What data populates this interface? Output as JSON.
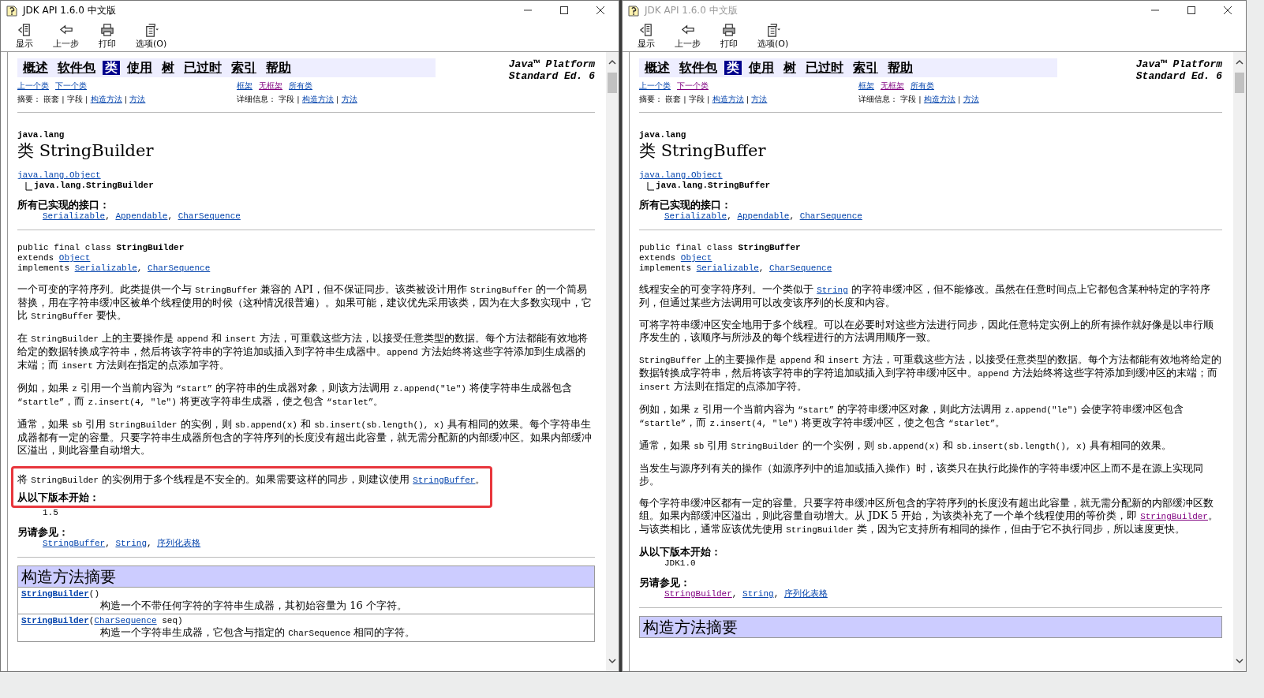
{
  "windows": [
    {
      "title": "JDK API 1.6.0 中文版",
      "active": true,
      "toolbar": [
        {
          "label": "显示"
        },
        {
          "label": "上一步"
        },
        {
          "label": "打印"
        },
        {
          "label": "选项(O)"
        }
      ],
      "nav": [
        {
          "label": "概述",
          "selected": false
        },
        {
          "label": "软件包",
          "selected": false
        },
        {
          "label": "类",
          "selected": true
        },
        {
          "label": "使用",
          "selected": false
        },
        {
          "label": "树",
          "selected": false
        },
        {
          "label": "已过时",
          "selected": false
        },
        {
          "label": "索引",
          "selected": false
        },
        {
          "label": "帮助",
          "selected": false
        }
      ],
      "platform": [
        "Java™ Platform",
        "Standard Ed. 6"
      ],
      "prev_next": [
        {
          "link": "上一个类",
          "visited": false
        },
        {
          "link": "下一个类",
          "visited": false
        }
      ],
      "frames": [
        {
          "link": "框架",
          "visited": false
        },
        {
          "link": "无框架",
          "visited": true
        },
        {
          "link": "所有类",
          "visited": false
        }
      ],
      "summary_line": [
        {
          "text": "摘要： 嵌套 | 字段 | "
        },
        {
          "link": "构造方法",
          "visited": false
        },
        {
          "text": " | "
        },
        {
          "link": "方法",
          "visited": false
        }
      ],
      "detail_line": [
        {
          "text": "详细信息： 字段 | "
        },
        {
          "link": "构造方法",
          "visited": false
        },
        {
          "text": " | "
        },
        {
          "link": "方法",
          "visited": false
        }
      ],
      "package": "java.lang",
      "class_title": "类 StringBuilder",
      "hierarchy": {
        "parent": "java.lang.Object",
        "child": "java.lang.StringBuilder"
      },
      "interfaces": {
        "label": "所有已实现的接口：",
        "items": [
          {
            "link": "Serializable",
            "visited": false
          },
          {
            "text": ", "
          },
          {
            "link": "Appendable",
            "visited": false
          },
          {
            "text": ", "
          },
          {
            "link": "CharSequence",
            "visited": false
          }
        ]
      },
      "signature": [
        [
          {
            "text": "public final class "
          },
          {
            "bold": "StringBuilder"
          }
        ],
        [
          {
            "text": "extends "
          },
          {
            "link": "Object",
            "visited": false
          }
        ],
        [
          {
            "text": "implements "
          },
          {
            "link": "Serializable",
            "visited": false
          },
          {
            "text": ", "
          },
          {
            "link": "CharSequence",
            "visited": false
          }
        ]
      ],
      "paragraphs": [
        {
          "highlighted": false,
          "segments": [
            {
              "text": "一个可变的字符序列。此类提供一个与 "
            },
            {
              "code": "StringBuffer"
            },
            {
              "text": " 兼容的 API，但不保证同步。该类被设计用作 "
            },
            {
              "code": "StringBuffer"
            },
            {
              "text": " 的一个简易替换，用在字符串缓冲区被单个线程使用的时候（这种情况很普遍）。如果可能，建议优先采用该类，因为在大多数实现中，它比 "
            },
            {
              "code": "StringBuffer"
            },
            {
              "text": " 要快。"
            }
          ]
        },
        {
          "highlighted": false,
          "segments": [
            {
              "text": "在 "
            },
            {
              "code": "StringBuilder"
            },
            {
              "text": " 上的主要操作是 "
            },
            {
              "code": "append"
            },
            {
              "text": " 和 "
            },
            {
              "code": "insert"
            },
            {
              "text": " 方法，可重载这些方法，以接受任意类型的数据。每个方法都能有效地将给定的数据转换成字符串，然后将该字符串的字符追加或插入到字符串生成器中。"
            },
            {
              "code": "append"
            },
            {
              "text": " 方法始终将这些字符添加到生成器的末端；而 "
            },
            {
              "code": "insert"
            },
            {
              "text": " 方法则在指定的点添加字符。"
            }
          ]
        },
        {
          "highlighted": false,
          "segments": [
            {
              "text": "例如，如果 "
            },
            {
              "code": "z"
            },
            {
              "text": " 引用一个当前内容为 "
            },
            {
              "code": "“start”"
            },
            {
              "text": " 的字符串的生成器对象，则该方法调用 "
            },
            {
              "code": "z.append(\"le\")"
            },
            {
              "text": " 将使字符串生成器包含 "
            },
            {
              "code": "“startle”"
            },
            {
              "text": "，而 "
            },
            {
              "code": "z.insert(4, \"le\")"
            },
            {
              "text": " 将更改字符串生成器，使之包含 "
            },
            {
              "code": "“starlet”"
            },
            {
              "text": "。"
            }
          ]
        },
        {
          "highlighted": false,
          "segments": [
            {
              "text": "通常，如果 "
            },
            {
              "code": "sb"
            },
            {
              "text": " 引用 "
            },
            {
              "code": "StringBuilder"
            },
            {
              "text": " 的实例，则 "
            },
            {
              "code": "sb.append(x)"
            },
            {
              "text": " 和 "
            },
            {
              "code": "sb.insert(sb.length(), x)"
            },
            {
              "text": " 具有相同的效果。每个字符串生成器都有一定的容量。只要字符串生成器所包含的字符序列的长度没有超出此容量，就无需分配新的内部缓冲区。如果内部缓冲区溢出，则此容量自动增大。"
            }
          ]
        },
        {
          "highlighted": true,
          "segments": [
            {
              "text": "将 "
            },
            {
              "code": "StringBuilder"
            },
            {
              "text": " 的实例用于多个线程是不安全的。如果需要这样的同步，则建议使用 "
            },
            {
              "link": "StringBuffer",
              "visited": false
            },
            {
              "text": "。"
            }
          ]
        }
      ],
      "since": {
        "label": "从以下版本开始：",
        "version": "1.5",
        "highlighted": true
      },
      "see_also": {
        "label": "另请参见：",
        "items": [
          {
            "link": "StringBuffer",
            "visited": false
          },
          {
            "text": ", "
          },
          {
            "link": "String",
            "visited": false
          },
          {
            "text": ", "
          },
          {
            "link": "序列化表格",
            "visited": false
          }
        ]
      },
      "constructor_summary": {
        "title": "构造方法摘要",
        "rows": [
          {
            "name": [
              {
                "link": "StringBuilder",
                "visited": false
              },
              {
                "text": "()"
              }
            ],
            "description": [
              {
                "text": "构造一个不带任何字符的字符串生成器，其初始容量为 16 个字符。"
              }
            ]
          },
          {
            "name": [
              {
                "link": "StringBuilder",
                "visited": false
              },
              {
                "text": "("
              },
              {
                "link": "CharSequence",
                "visited": false
              },
              {
                "text": " seq)"
              }
            ],
            "description": [
              {
                "text": "构造一个字符串生成器，它包含与指定的 "
              },
              {
                "code": "CharSequence"
              },
              {
                "text": " 相同的字符。"
              }
            ]
          }
        ]
      }
    },
    {
      "title": "JDK API 1.6.0 中文版",
      "active": false,
      "toolbar": [
        {
          "label": "显示"
        },
        {
          "label": "上一步"
        },
        {
          "label": "打印"
        },
        {
          "label": "选项(O)"
        }
      ],
      "nav": [
        {
          "label": "概述",
          "selected": false
        },
        {
          "label": "软件包",
          "selected": false
        },
        {
          "label": "类",
          "selected": true
        },
        {
          "label": "使用",
          "selected": false
        },
        {
          "label": "树",
          "selected": false
        },
        {
          "label": "已过时",
          "selected": false
        },
        {
          "label": "索引",
          "selected": false
        },
        {
          "label": "帮助",
          "selected": false
        }
      ],
      "platform": [
        "Java™ Platform",
        "Standard Ed. 6"
      ],
      "prev_next": [
        {
          "link": "上一个类",
          "visited": false
        },
        {
          "link": "下一个类",
          "visited": true
        }
      ],
      "frames": [
        {
          "link": "框架",
          "visited": false
        },
        {
          "link": "无框架",
          "visited": true
        },
        {
          "link": "所有类",
          "visited": false
        }
      ],
      "summary_line": [
        {
          "text": "摘要： 嵌套 | 字段 | "
        },
        {
          "link": "构造方法",
          "visited": false
        },
        {
          "text": " | "
        },
        {
          "link": "方法",
          "visited": false
        }
      ],
      "detail_line": [
        {
          "text": "详细信息： 字段 | "
        },
        {
          "link": "构造方法",
          "visited": false
        },
        {
          "text": " | "
        },
        {
          "link": "方法",
          "visited": false
        }
      ],
      "package": "java.lang",
      "class_title": "类 StringBuffer",
      "hierarchy": {
        "parent": "java.lang.Object",
        "child": "java.lang.StringBuffer"
      },
      "interfaces": {
        "label": "所有已实现的接口：",
        "items": [
          {
            "link": "Serializable",
            "visited": false
          },
          {
            "text": ", "
          },
          {
            "link": "Appendable",
            "visited": false
          },
          {
            "text": ", "
          },
          {
            "link": "CharSequence",
            "visited": false
          }
        ]
      },
      "signature": [
        [
          {
            "text": "public final class "
          },
          {
            "bold": "StringBuffer"
          }
        ],
        [
          {
            "text": "extends "
          },
          {
            "link": "Object",
            "visited": false
          }
        ],
        [
          {
            "text": "implements "
          },
          {
            "link": "Serializable",
            "visited": false
          },
          {
            "text": ", "
          },
          {
            "link": "CharSequence",
            "visited": false
          }
        ]
      ],
      "paragraphs": [
        {
          "highlighted": false,
          "segments": [
            {
              "text": "线程安全的可变字符序列。一个类似于 "
            },
            {
              "link": "String",
              "visited": false
            },
            {
              "text": " 的字符串缓冲区，但不能修改。虽然在任意时间点上它都包含某种特定的字符序列，但通过某些方法调用可以改变该序列的长度和内容。"
            }
          ]
        },
        {
          "highlighted": false,
          "segments": [
            {
              "text": "可将字符串缓冲区安全地用于多个线程。可以在必要时对这些方法进行同步，因此任意特定实例上的所有操作就好像是以串行顺序发生的，该顺序与所涉及的每个线程进行的方法调用顺序一致。"
            }
          ]
        },
        {
          "highlighted": false,
          "segments": [
            {
              "code": "StringBuffer"
            },
            {
              "text": " 上的主要操作是 "
            },
            {
              "code": "append"
            },
            {
              "text": " 和 "
            },
            {
              "code": "insert"
            },
            {
              "text": " 方法，可重载这些方法，以接受任意类型的数据。每个方法都能有效地将给定的数据转换成字符串，然后将该字符串的字符追加或插入到字符串缓冲区中。"
            },
            {
              "code": "append"
            },
            {
              "text": " 方法始终将这些字符添加到缓冲区的末端；而 "
            },
            {
              "code": "insert"
            },
            {
              "text": " 方法则在指定的点添加字符。"
            }
          ]
        },
        {
          "highlighted": false,
          "segments": [
            {
              "text": "例如，如果 "
            },
            {
              "code": "z"
            },
            {
              "text": " 引用一个当前内容为 "
            },
            {
              "code": "“start”"
            },
            {
              "text": " 的字符串缓冲区对象，则此方法调用 "
            },
            {
              "code": "z.append(\"le\")"
            },
            {
              "text": " 会使字符串缓冲区包含 "
            },
            {
              "code": "“startle”"
            },
            {
              "text": "，而 "
            },
            {
              "code": "z.insert(4, \"le\")"
            },
            {
              "text": " 将更改字符串缓冲区，使之包含 "
            },
            {
              "code": "“starlet”"
            },
            {
              "text": "。"
            }
          ]
        },
        {
          "highlighted": false,
          "segments": [
            {
              "text": "通常，如果 "
            },
            {
              "code": "sb"
            },
            {
              "text": " 引用 "
            },
            {
              "code": "StringBuilder"
            },
            {
              "text": " 的一个实例，则 "
            },
            {
              "code": "sb.append(x)"
            },
            {
              "text": " 和 "
            },
            {
              "code": "sb.insert(sb.length(), x)"
            },
            {
              "text": " 具有相同的效果。"
            }
          ]
        },
        {
          "highlighted": false,
          "segments": [
            {
              "text": "当发生与源序列有关的操作（如源序列中的追加或插入操作）时，该类只在执行此操作的字符串缓冲区上而不是在源上实现同步。"
            }
          ]
        },
        {
          "highlighted": false,
          "segments": [
            {
              "text": "每个字符串缓冲区都有一定的容量。只要字符串缓冲区所包含的字符序列的长度没有超出此容量，就无需分配新的内部缓冲区数组。如果内部缓冲区溢出，则此容量自动增大。从 JDK 5 开始，为该类补充了一个单个线程使用的等价类，即 "
            },
            {
              "link": "StringBuilder",
              "visited": true
            },
            {
              "text": "。与该类相比，通常应该优先使用 "
            },
            {
              "code": "StringBuilder"
            },
            {
              "text": " 类，因为它支持所有相同的操作，但由于它不执行同步，所以速度更快。"
            }
          ]
        }
      ],
      "since": {
        "label": "从以下版本开始：",
        "version": "JDK1.0",
        "highlighted": false
      },
      "see_also": {
        "label": "另请参见：",
        "items": [
          {
            "link": "StringBuilder",
            "visited": true
          },
          {
            "text": ", "
          },
          {
            "link": "String",
            "visited": false
          },
          {
            "text": ", "
          },
          {
            "link": "序列化表格",
            "visited": false
          }
        ]
      },
      "constructor_summary": {
        "title": "构造方法摘要"
      }
    }
  ]
}
